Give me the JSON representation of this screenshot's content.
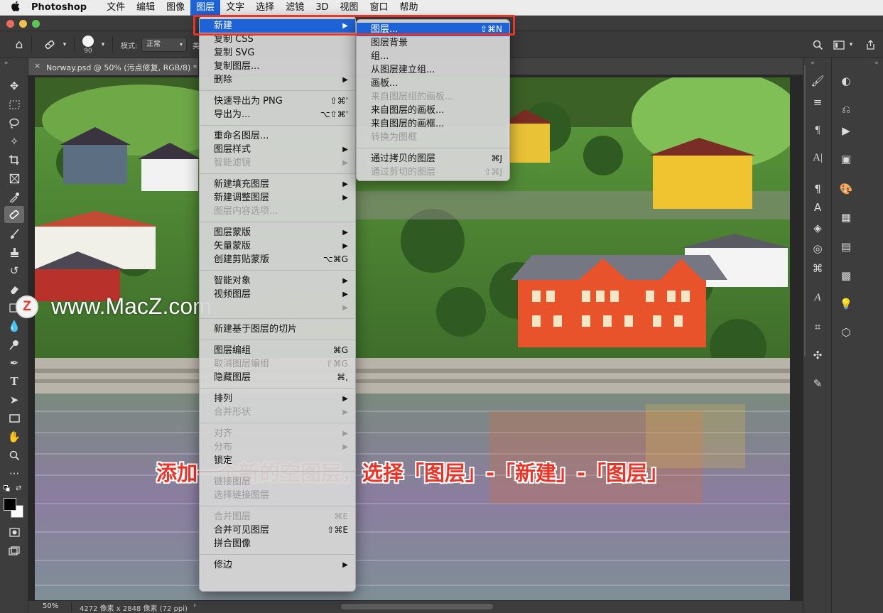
{
  "menubar": {
    "app_name": "Photoshop",
    "items": [
      "文件",
      "编辑",
      "图像",
      "图层",
      "文字",
      "选择",
      "滤镜",
      "3D",
      "视图",
      "窗口",
      "帮助"
    ],
    "active_index": 3
  },
  "options": {
    "brush_size": "90",
    "mode_label": "模式:",
    "mode_value": "正常",
    "clipped_label": "类"
  },
  "document": {
    "tab_title": "Norway.psd @ 50% (污点修复, RGB/8) *"
  },
  "status": {
    "zoom": "50%",
    "doc_info": "4272 像素 x 2848 像素 (72 ppi)"
  },
  "layer_menu": {
    "groups": [
      [
        {
          "label": "新建",
          "arrow": true,
          "highlight": true
        },
        {
          "label": "复制 CSS"
        },
        {
          "label": "复制 SVG"
        },
        {
          "label": "复制图层..."
        },
        {
          "label": "删除",
          "arrow": true
        }
      ],
      [
        {
          "label": "快速导出为 PNG",
          "shortcut": "⇧⌘'"
        },
        {
          "label": "导出为...",
          "shortcut": "⌥⇧⌘'"
        }
      ],
      [
        {
          "label": "重命名图层..."
        },
        {
          "label": "图层样式",
          "arrow": true
        },
        {
          "label": "智能滤镜",
          "arrow": true,
          "disabled": true
        }
      ],
      [
        {
          "label": "新建填充图层",
          "arrow": true
        },
        {
          "label": "新建调整图层",
          "arrow": true
        },
        {
          "label": "图层内容选项...",
          "disabled": true
        }
      ],
      [
        {
          "label": "图层蒙版",
          "arrow": true
        },
        {
          "label": "矢量蒙版",
          "arrow": true
        },
        {
          "label": "创建剪贴蒙版",
          "shortcut": "⌥⌘G"
        }
      ],
      [
        {
          "label": "智能对象",
          "arrow": true
        },
        {
          "label": "视频图层",
          "arrow": true
        },
        {
          "label": "",
          "arrow": true,
          "disabled": true
        }
      ],
      [
        {
          "label": "新建基于图层的切片"
        }
      ],
      [
        {
          "label": "图层编组",
          "shortcut": "⌘G"
        },
        {
          "label": "取消图层编组",
          "shortcut": "⇧⌘G",
          "disabled": true
        },
        {
          "label": "隐藏图层",
          "shortcut": "⌘,"
        }
      ],
      [
        {
          "label": "排列",
          "arrow": true
        },
        {
          "label": "合并形状",
          "arrow": true,
          "disabled": true
        }
      ],
      [
        {
          "label": "对齐",
          "arrow": true,
          "disabled": true
        },
        {
          "label": "分布",
          "arrow": true,
          "disabled": true
        },
        {
          "label": "锁定"
        }
      ],
      [
        {
          "label": "链接图层",
          "disabled": true
        },
        {
          "label": "选择链接图层",
          "disabled": true
        }
      ],
      [
        {
          "label": "合并图层",
          "shortcut": "⌘E",
          "disabled": true
        },
        {
          "label": "合并可见图层",
          "shortcut": "⇧⌘E"
        },
        {
          "label": "拼合图像"
        }
      ],
      [
        {
          "label": "修边",
          "arrow": true
        }
      ]
    ]
  },
  "new_submenu": {
    "groups": [
      [
        {
          "label": "图层...",
          "shortcut": "⇧⌘N",
          "highlight": true
        },
        {
          "label": "图层背景"
        },
        {
          "label": "组..."
        },
        {
          "label": "从图层建立组..."
        },
        {
          "label": "画板..."
        },
        {
          "label": "来自图层组的画板...",
          "disabled": true
        },
        {
          "label": "来自图层的画板..."
        },
        {
          "label": "来自图层的画框..."
        },
        {
          "label": "转换为图框",
          "disabled": true
        }
      ],
      [
        {
          "label": "通过拷贝的图层",
          "shortcut": "⌘J"
        },
        {
          "label": "通过剪切的图层",
          "shortcut": "⇧⌘J",
          "disabled": true
        }
      ]
    ]
  },
  "watermark": {
    "logo_letter": "Z",
    "text": "www.MacZ.com"
  },
  "caption": "添加一个新的空图层，选择「图层」-「新建」-「图层」",
  "colors": {
    "accent": "#1e63d6",
    "highlight_box": "#e8352a",
    "caption": "#e8352a"
  }
}
